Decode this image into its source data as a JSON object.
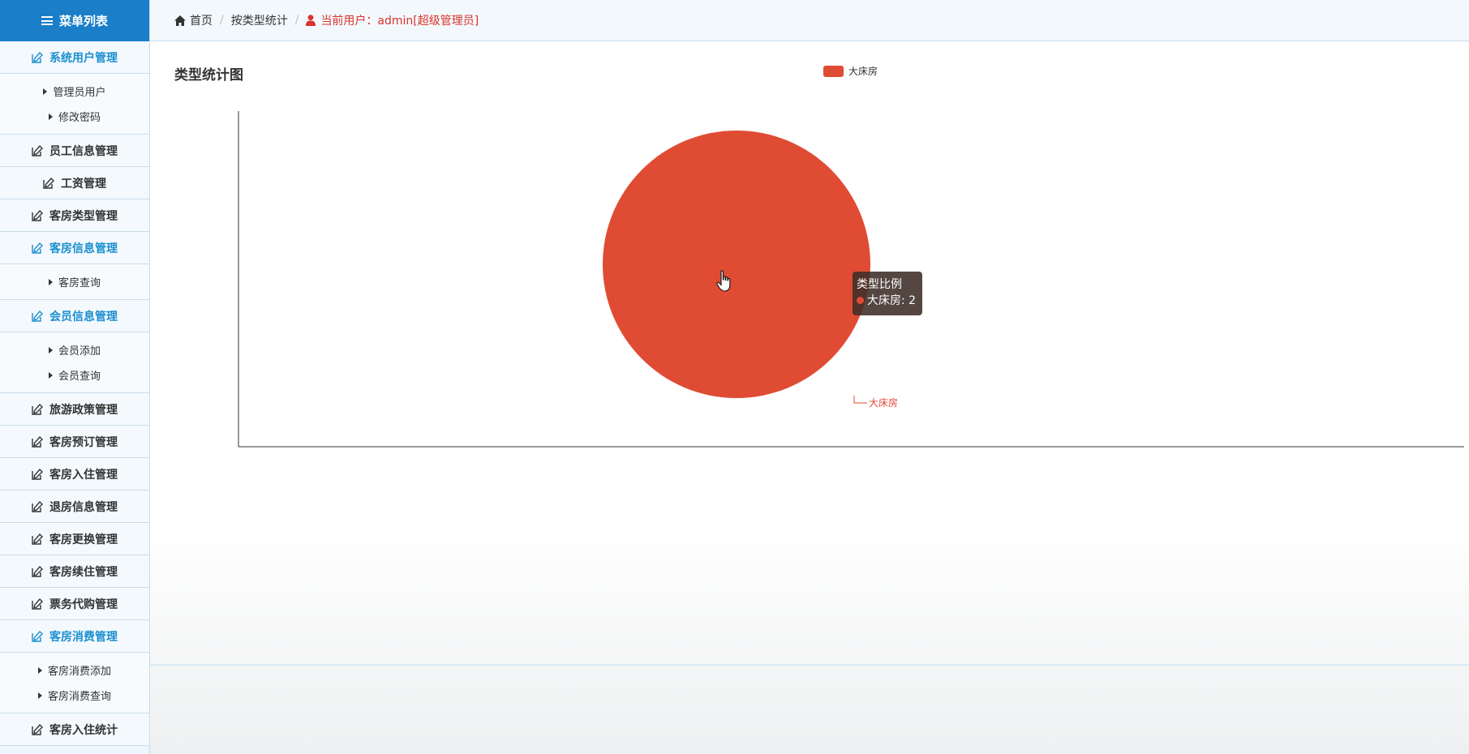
{
  "sidebar": {
    "title": "菜单列表",
    "groups": [
      {
        "label": "系统用户管理",
        "open": true,
        "items": [
          "管理员用户",
          "修改密码"
        ]
      },
      {
        "label": "员工信息管理",
        "open": false,
        "items": []
      },
      {
        "label": "工资管理",
        "open": false,
        "items": []
      },
      {
        "label": "客房类型管理",
        "open": false,
        "items": []
      },
      {
        "label": "客房信息管理",
        "open": true,
        "items": [
          "客房查询"
        ]
      },
      {
        "label": "会员信息管理",
        "open": true,
        "items": [
          "会员添加",
          "会员查询"
        ]
      },
      {
        "label": "旅游政策管理",
        "open": false,
        "items": []
      },
      {
        "label": "客房预订管理",
        "open": false,
        "items": []
      },
      {
        "label": "客房入住管理",
        "open": false,
        "items": []
      },
      {
        "label": "退房信息管理",
        "open": false,
        "items": []
      },
      {
        "label": "客房更换管理",
        "open": false,
        "items": []
      },
      {
        "label": "客房续住管理",
        "open": false,
        "items": []
      },
      {
        "label": "票务代购管理",
        "open": false,
        "items": []
      },
      {
        "label": "客房消费管理",
        "open": true,
        "items": [
          "客房消费添加",
          "客房消费查询"
        ]
      },
      {
        "label": "客房入住统计",
        "open": false,
        "items": []
      }
    ]
  },
  "breadcrumb": {
    "home": "首页",
    "page": "按类型统计",
    "current_user": "当前用户：admin[超级管理员]"
  },
  "main": {
    "section_title": "类型统计图"
  },
  "chart_data": {
    "type": "pie",
    "series_name": "类型比例",
    "categories": [
      "大床房"
    ],
    "values": [
      2
    ],
    "colors": [
      "#e04b34"
    ],
    "legend": [
      "大床房"
    ],
    "legend_position": "top-center",
    "slice_labels": [
      "大床房"
    ],
    "tooltip": {
      "title": "类型比例",
      "entry": "大床房: 2"
    }
  },
  "colors": {
    "sidebar_header": "#1a7ec8",
    "active_group": "#1a8fd0",
    "current_user": "#d9342b",
    "pie": "#e04b34"
  }
}
